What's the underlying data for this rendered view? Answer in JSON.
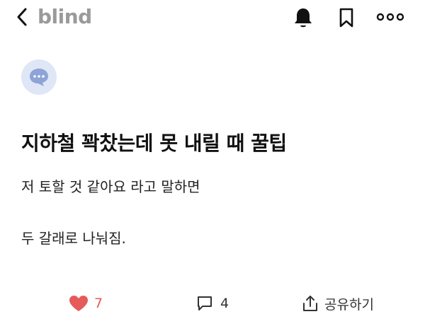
{
  "header": {
    "brand": "blind",
    "icons": [
      "back-icon",
      "bell-icon",
      "bookmark-icon",
      "more-icon"
    ]
  },
  "post": {
    "title": "지하철 꽉찼는데 못 내릴 때 꿀팁",
    "body_lines": [
      "저 토할 것 같아요 라고 말하면",
      "두 갈래로 나눠짐."
    ]
  },
  "actions": {
    "like_count": "7",
    "comment_count": "4",
    "share_label": "공유하기"
  },
  "colors": {
    "like": "#e55a5a",
    "brand_logo": "#9a9a9a",
    "avatar_bg": "#dfe6f6",
    "avatar_bubble": "#8ea3d6",
    "text": "#111111"
  }
}
